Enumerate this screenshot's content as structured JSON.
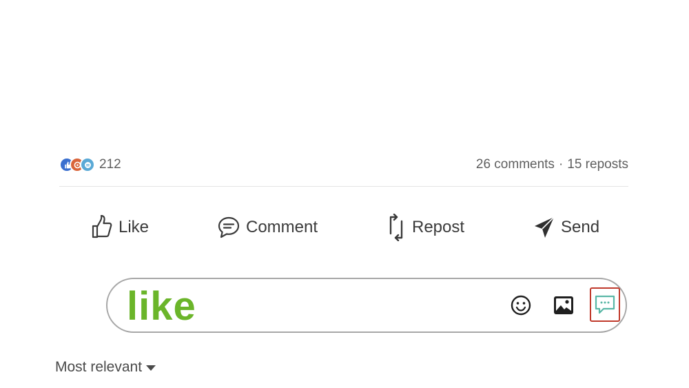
{
  "reactions": {
    "icons": [
      "like-reaction-icon",
      "celebrate-reaction-icon",
      "support-reaction-icon"
    ],
    "count": "212"
  },
  "stats": {
    "comments": "26 comments",
    "separator": "·",
    "reposts": "15 reposts"
  },
  "actions": {
    "like_label": "Like",
    "comment_label": "Comment",
    "repost_label": "Repost",
    "send_label": "Send"
  },
  "composer": {
    "value": "like",
    "text_color": "#6bb52a",
    "icons": [
      "emoji-icon",
      "image-icon",
      "message-icon"
    ],
    "highlight_color": "#c0392b"
  },
  "sort": {
    "label": "Most relevant",
    "icon": "caret-down-icon"
  }
}
